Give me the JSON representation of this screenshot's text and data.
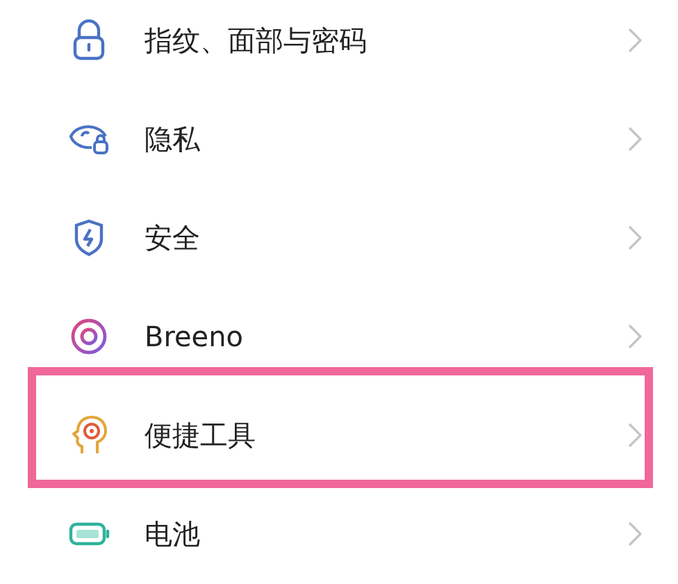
{
  "settings_items": [
    {
      "kind": "lock",
      "label": "指纹、面部与密码",
      "highlighted": false
    },
    {
      "kind": "eye",
      "label": "隐私",
      "highlighted": false
    },
    {
      "kind": "shield",
      "label": "安全",
      "highlighted": false
    },
    {
      "kind": "ring",
      "label": "Breeno",
      "highlighted": false
    },
    {
      "kind": "head",
      "label": "便捷工具",
      "highlighted": true
    },
    {
      "kind": "battery",
      "label": "电池",
      "highlighted": false
    }
  ]
}
